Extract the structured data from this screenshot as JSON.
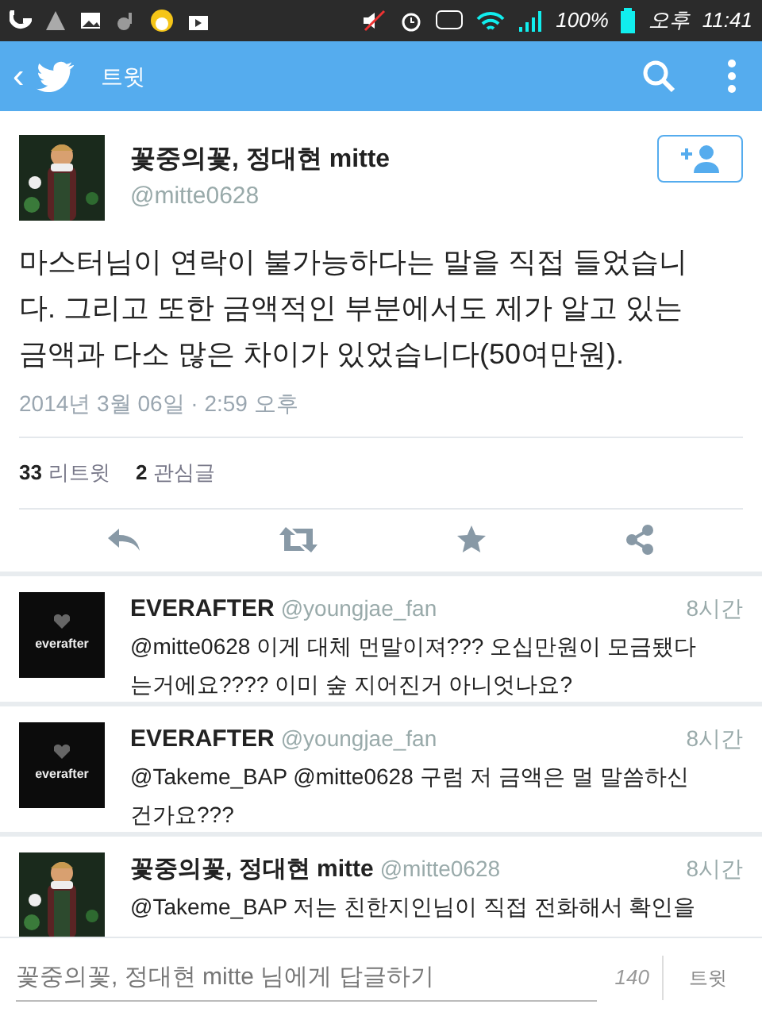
{
  "status_bar": {
    "battery": "100%",
    "ampm": "오후",
    "time": "11:41"
  },
  "app_bar": {
    "back": "‹",
    "title": "트윗"
  },
  "tweet": {
    "name": "꽃중의꽃, 정대현 mitte",
    "handle": "@mitte0628",
    "text": "마스터님이 연락이 불가능하다는 말을 직접 들었습니다. 그리고 또한 금액적인 부분에서도 제가 알고 있는 금액과 다소 많은 차이가 있었습니다(50여만원).",
    "date": "2014년 3월 06일 · 2:59 오후",
    "stats": [
      {
        "count": "33",
        "label": "리트윗"
      },
      {
        "count": "2",
        "label": "관심글"
      }
    ]
  },
  "replies": [
    {
      "kind": "logo",
      "logo_text": "everafter",
      "name": "EVERAFTER",
      "handle": "@youngjae_fan",
      "time": "8시간",
      "text": "@mitte0628 이게 대체 먼말이져??? 오십만원이 모금됐다는거에요???? 이미 숲 지어진거 아니엇나요?"
    },
    {
      "kind": "logo",
      "logo_text": "everafter",
      "name": "EVERAFTER",
      "handle": "@youngjae_fan",
      "time": "8시간",
      "text": "@Takeme_BAP @mitte0628 구럼 저 금액은 멀 말씀하신건가요???"
    },
    {
      "kind": "picture",
      "name": "꽃중의꽃, 정대현 mitte",
      "handle": "@mitte0628",
      "time": "8시간",
      "text": "@Takeme_BAP 저는 친한지인님이 직접 전화해서 확인을"
    }
  ],
  "reply_bar": {
    "placeholder": "꽃중의꽃, 정대현 mitte 님에게 답글하기",
    "counter": "140",
    "send": "트윗"
  }
}
